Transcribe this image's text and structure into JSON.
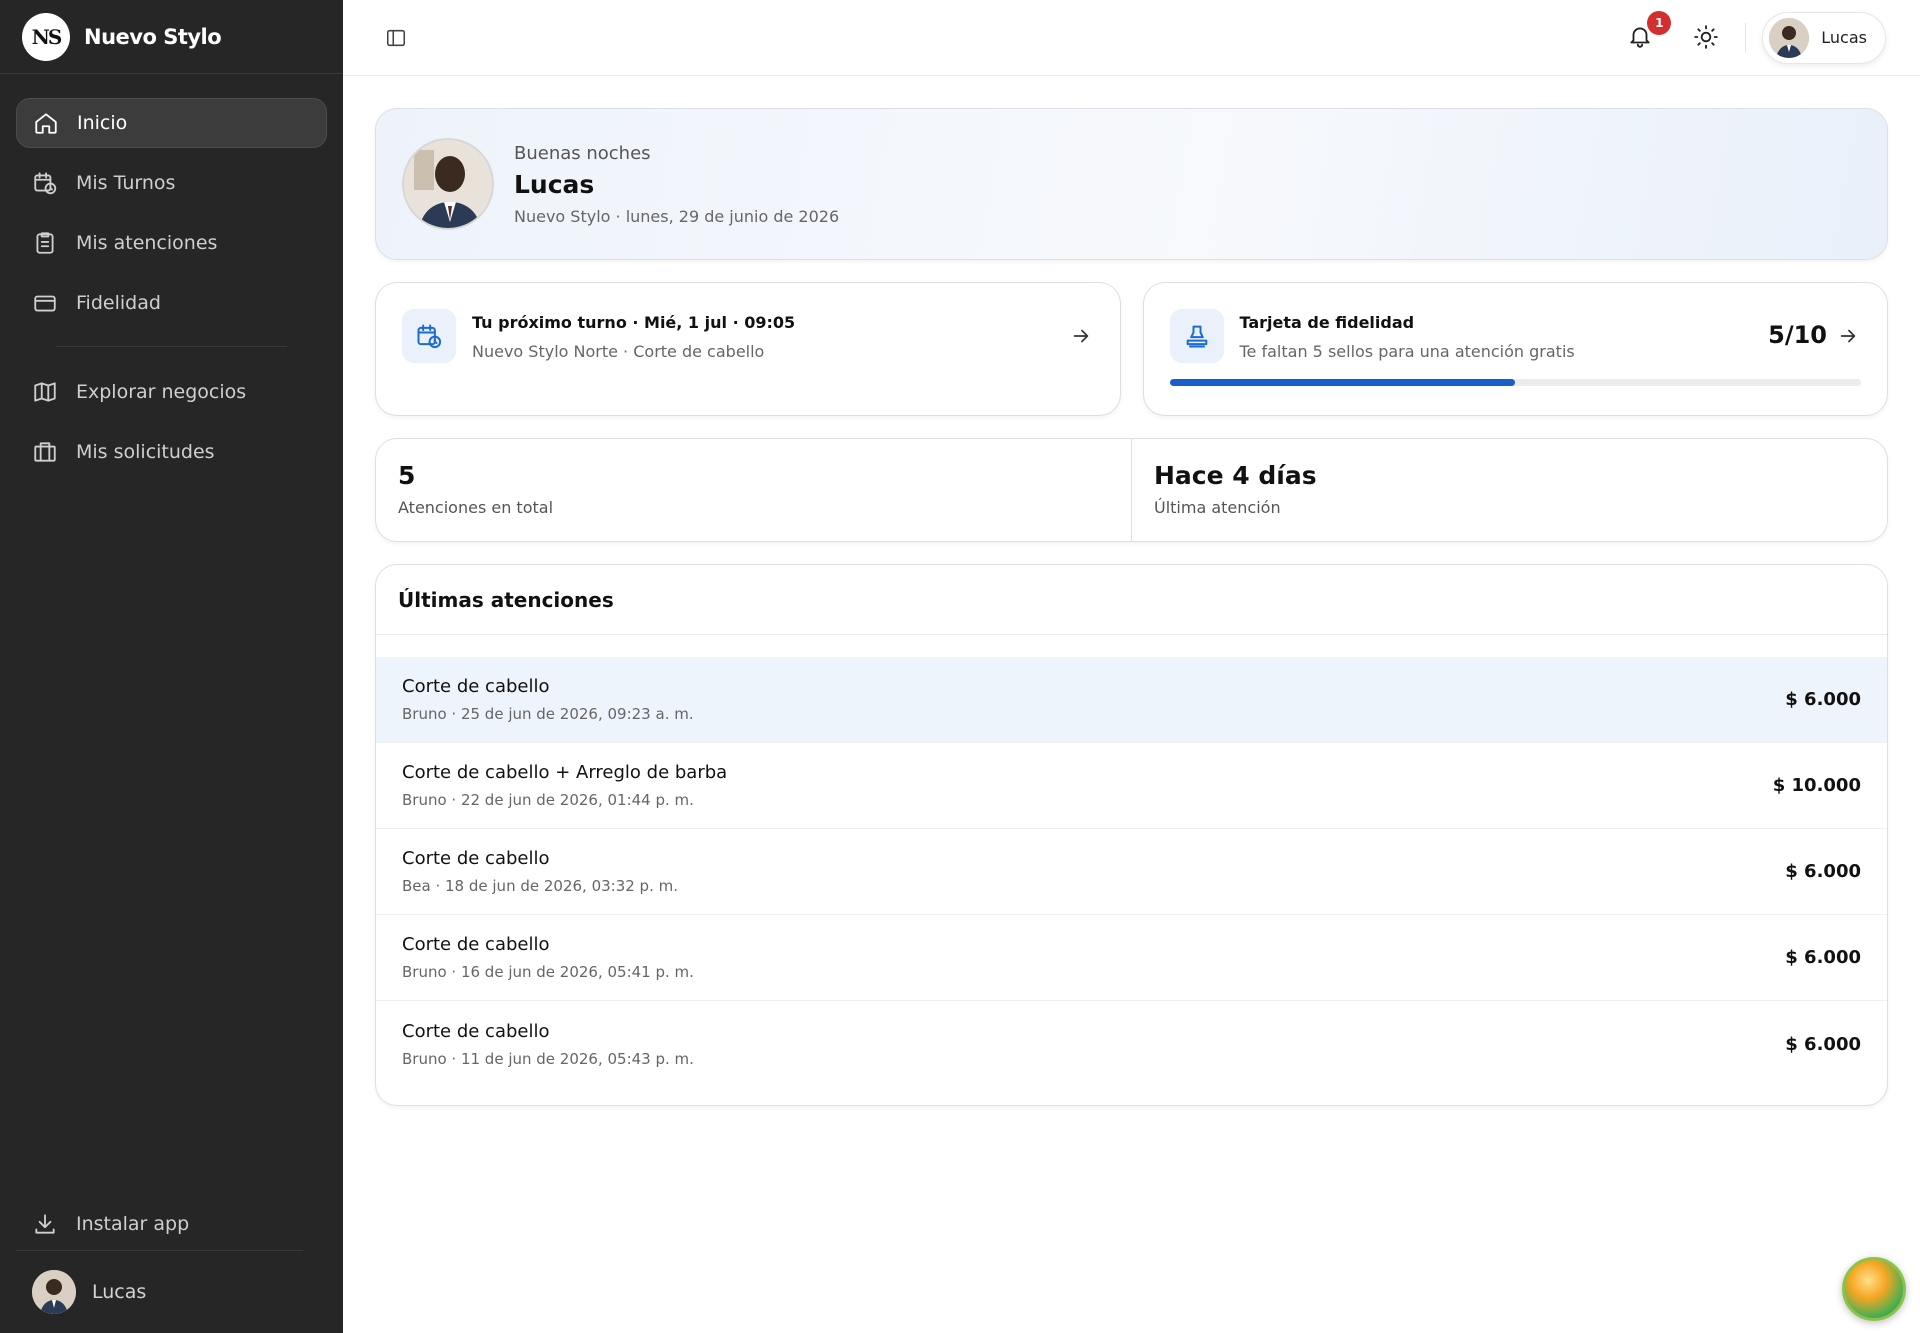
{
  "brand": {
    "logo_text": "NS",
    "name": "Nuevo Stylo"
  },
  "sidebar": {
    "items": [
      {
        "label": "Inicio",
        "icon": "home-icon",
        "active": true
      },
      {
        "label": "Mis Turnos",
        "icon": "calendar-clock-icon"
      },
      {
        "label": "Mis atenciones",
        "icon": "clipboard-icon"
      },
      {
        "label": "Fidelidad",
        "icon": "card-icon"
      },
      {
        "label": "Explorar negocios",
        "icon": "map-icon"
      },
      {
        "label": "Mis solicitudes",
        "icon": "briefcase-icon"
      }
    ],
    "install_label": "Instalar app",
    "user_name": "Lucas"
  },
  "topbar": {
    "notification_count": "1",
    "user_name": "Lucas"
  },
  "hero": {
    "greeting": "Buenas noches",
    "name": "Lucas",
    "subtitle": "Nuevo Stylo · lunes, 29 de junio de 2026"
  },
  "next_turn": {
    "title": "Tu próximo turno · Mié, 1 jul · 09:05",
    "subtitle": "Nuevo Stylo Norte · Corte de cabello"
  },
  "loyalty": {
    "title": "Tarjeta de fidelidad",
    "subtitle": "Te faltan 5 sellos para una atención gratis",
    "count": "5/10",
    "progress": 0.5
  },
  "stats": [
    {
      "value": "5",
      "label": "Atenciones en total"
    },
    {
      "value": "Hace 4 días",
      "label": "Última atención"
    }
  ],
  "recent": {
    "title": "Últimas atenciones",
    "rows": [
      {
        "service": "Corte de cabello",
        "detail": "Bruno · 25 de jun de 2026, 09:23 a. m.",
        "price": "$ 6.000"
      },
      {
        "service": "Corte de cabello + Arreglo de barba",
        "detail": "Bruno · 22 de jun de 2026, 01:44 p. m.",
        "price": "$ 10.000"
      },
      {
        "service": "Corte de cabello",
        "detail": "Bea · 18 de jun de 2026, 03:32 p. m.",
        "price": "$ 6.000"
      },
      {
        "service": "Corte de cabello",
        "detail": "Bruno · 16 de jun de 2026, 05:41 p. m.",
        "price": "$ 6.000"
      },
      {
        "service": "Corte de cabello",
        "detail": "Bruno · 11 de jun de 2026, 05:43 p. m.",
        "price": "$ 6.000"
      }
    ]
  },
  "colors": {
    "sidebar_bg": "#262626",
    "accent": "#1a5fc9",
    "badge": "#d32f2f"
  }
}
